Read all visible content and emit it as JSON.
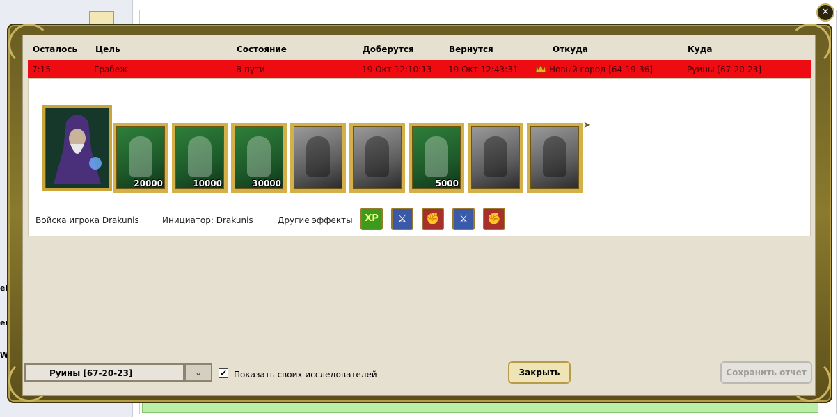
{
  "background": {
    "left_fragments": [
      "eR",
      "ers",
      "W"
    ]
  },
  "table": {
    "headers": [
      "Осталось",
      "Цель",
      "Состояние",
      "Доберутся",
      "Вернутся",
      "Откуда",
      "Куда"
    ],
    "row": {
      "remaining": "7:15",
      "goal": "Грабеж",
      "state": "В пути",
      "arrive": "19 Окт 12:10:13",
      "return": "19 Окт 12:43:31",
      "from": "Новый город [64-19-36]",
      "to": "Руины [67-20-23]"
    },
    "row_color": "#ee0b12"
  },
  "army": {
    "hero_icon": "wizard-hero-portrait",
    "units": [
      {
        "icon": "dwarf-warrior-icon",
        "count": "20000",
        "active": true
      },
      {
        "icon": "green-swordsman-icon",
        "count": "10000",
        "active": true
      },
      {
        "icon": "green-spearman-icon",
        "count": "30000",
        "active": true
      },
      {
        "icon": "griffin-icon",
        "count": "",
        "active": false
      },
      {
        "icon": "archer-icon",
        "count": "",
        "active": false
      },
      {
        "icon": "druid-icon",
        "count": "5000",
        "active": true
      },
      {
        "icon": "dark-knight-icon",
        "count": "",
        "active": false
      },
      {
        "icon": "ghost-icon",
        "count": "",
        "active": false
      }
    ]
  },
  "info": {
    "troops_of": "Войска игрока Drakunis",
    "initiator": "Инициатор: Drakunis",
    "other_effects": "Другие эффекты",
    "effects": [
      {
        "icon": "xp-icon",
        "text": "XP"
      },
      {
        "icon": "sword-icon",
        "text": ""
      },
      {
        "icon": "fist-icon",
        "text": ""
      },
      {
        "icon": "sword-icon",
        "text": ""
      },
      {
        "icon": "fist-icon",
        "text": ""
      }
    ]
  },
  "footer": {
    "select_value": "Руины [67-20-23]",
    "show_explorers_label": "Показать своих исследователей",
    "show_explorers_checked": true,
    "close_label": "Закрыть",
    "save_label": "Сохранить отчет"
  }
}
